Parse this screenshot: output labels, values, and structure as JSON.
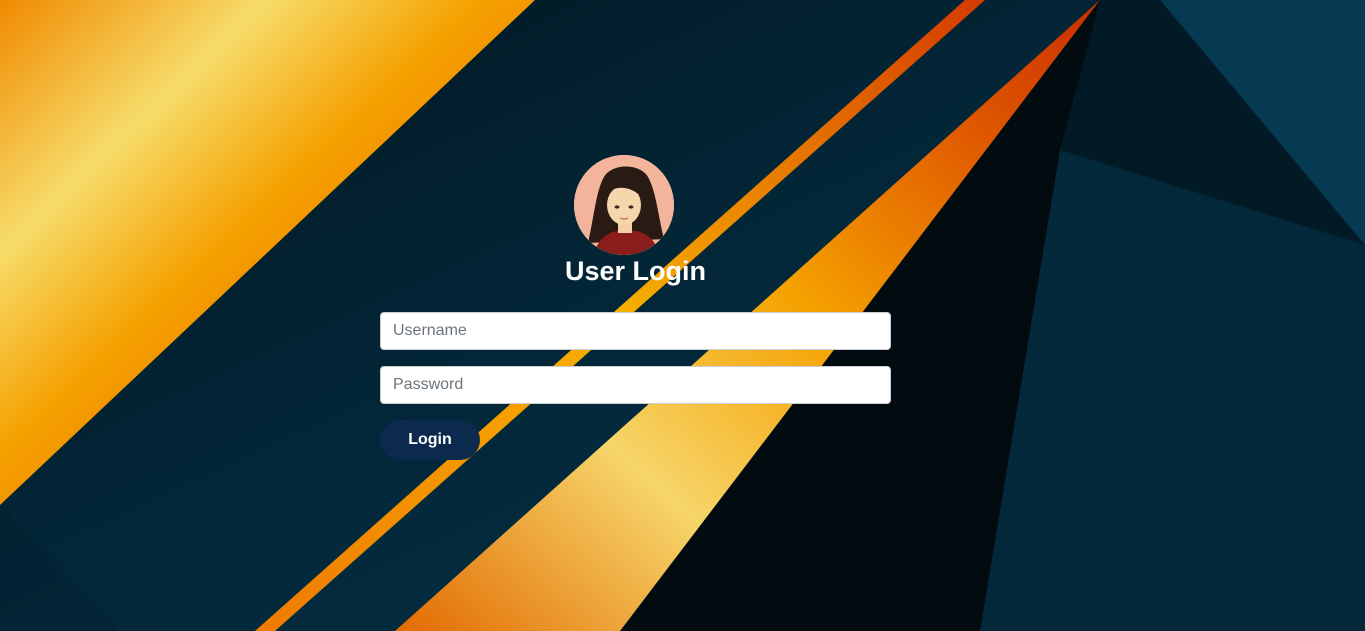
{
  "colors": {
    "background": "#03202e",
    "accent_orange": "#f08a00",
    "accent_yellow": "#f6dc6a",
    "accent_red": "#c92d00",
    "button": "#0c2a4e"
  },
  "avatar": {
    "icon": "user-avatar-illustration"
  },
  "login": {
    "title": "User Login",
    "username_placeholder": "Username",
    "username_value": "",
    "password_placeholder": "Password",
    "password_value": "",
    "button_label": "Login"
  }
}
